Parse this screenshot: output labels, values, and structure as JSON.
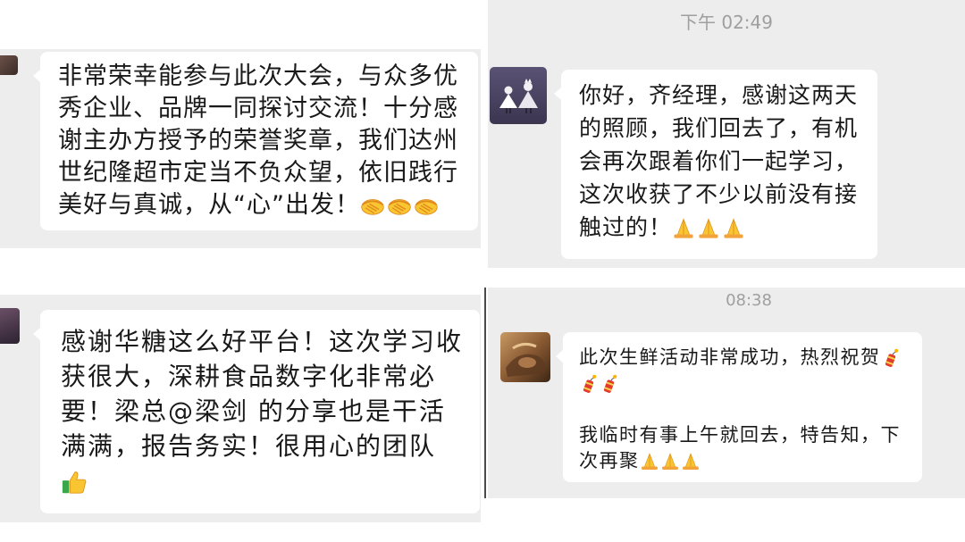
{
  "chats": [
    {
      "id": "top-left",
      "bubble_lines": [
        "非常荣幸能参与此次大会，与众多优",
        "秀企业、品牌一同探讨交流！十分感",
        "谢主办方授予的荣誉奖章，我们达州",
        "世纪隆超市定当不负众望，依旧践行",
        "美好与真诚，从“心”出发！"
      ],
      "emoji": [
        "handshake",
        "handshake",
        "handshake"
      ]
    },
    {
      "id": "bottom-left",
      "bubble_lines": [
        "感谢华糖这么好平台！这次学习收",
        "获很大，深耕食品数字化非常必",
        "要！梁总@梁剑  的分享也是干活",
        "满满，报告务实！很用心的团队"
      ],
      "emoji": [
        "thumbs-up"
      ]
    },
    {
      "id": "top-right",
      "timestamp": "下午 02:49",
      "bubble_lines": [
        "你好，齐经理，感谢这两天",
        "的照顾，我们回去了，有机",
        "会再次跟着你们一起学习，",
        "这次收获了不少以前没有接",
        "触过的！"
      ],
      "emoji": [
        "folded-hands",
        "folded-hands",
        "folded-hands"
      ]
    },
    {
      "id": "bottom-right",
      "timestamp": "08:38",
      "bubble_lines": [
        "此次生鲜活动非常成功，热烈祝贺",
        "",
        "",
        "我临时有事上午就回去，特告知，下",
        "次再聚"
      ],
      "emoji": [
        "firecracker",
        "firecracker",
        "firecracker",
        "folded-hands",
        "folded-hands",
        "folded-hands"
      ]
    }
  ],
  "colors": {
    "chat_background": "#ededed",
    "bubble": "#ffffff",
    "timestamp": "#9f9f9f",
    "text": "#191919"
  }
}
